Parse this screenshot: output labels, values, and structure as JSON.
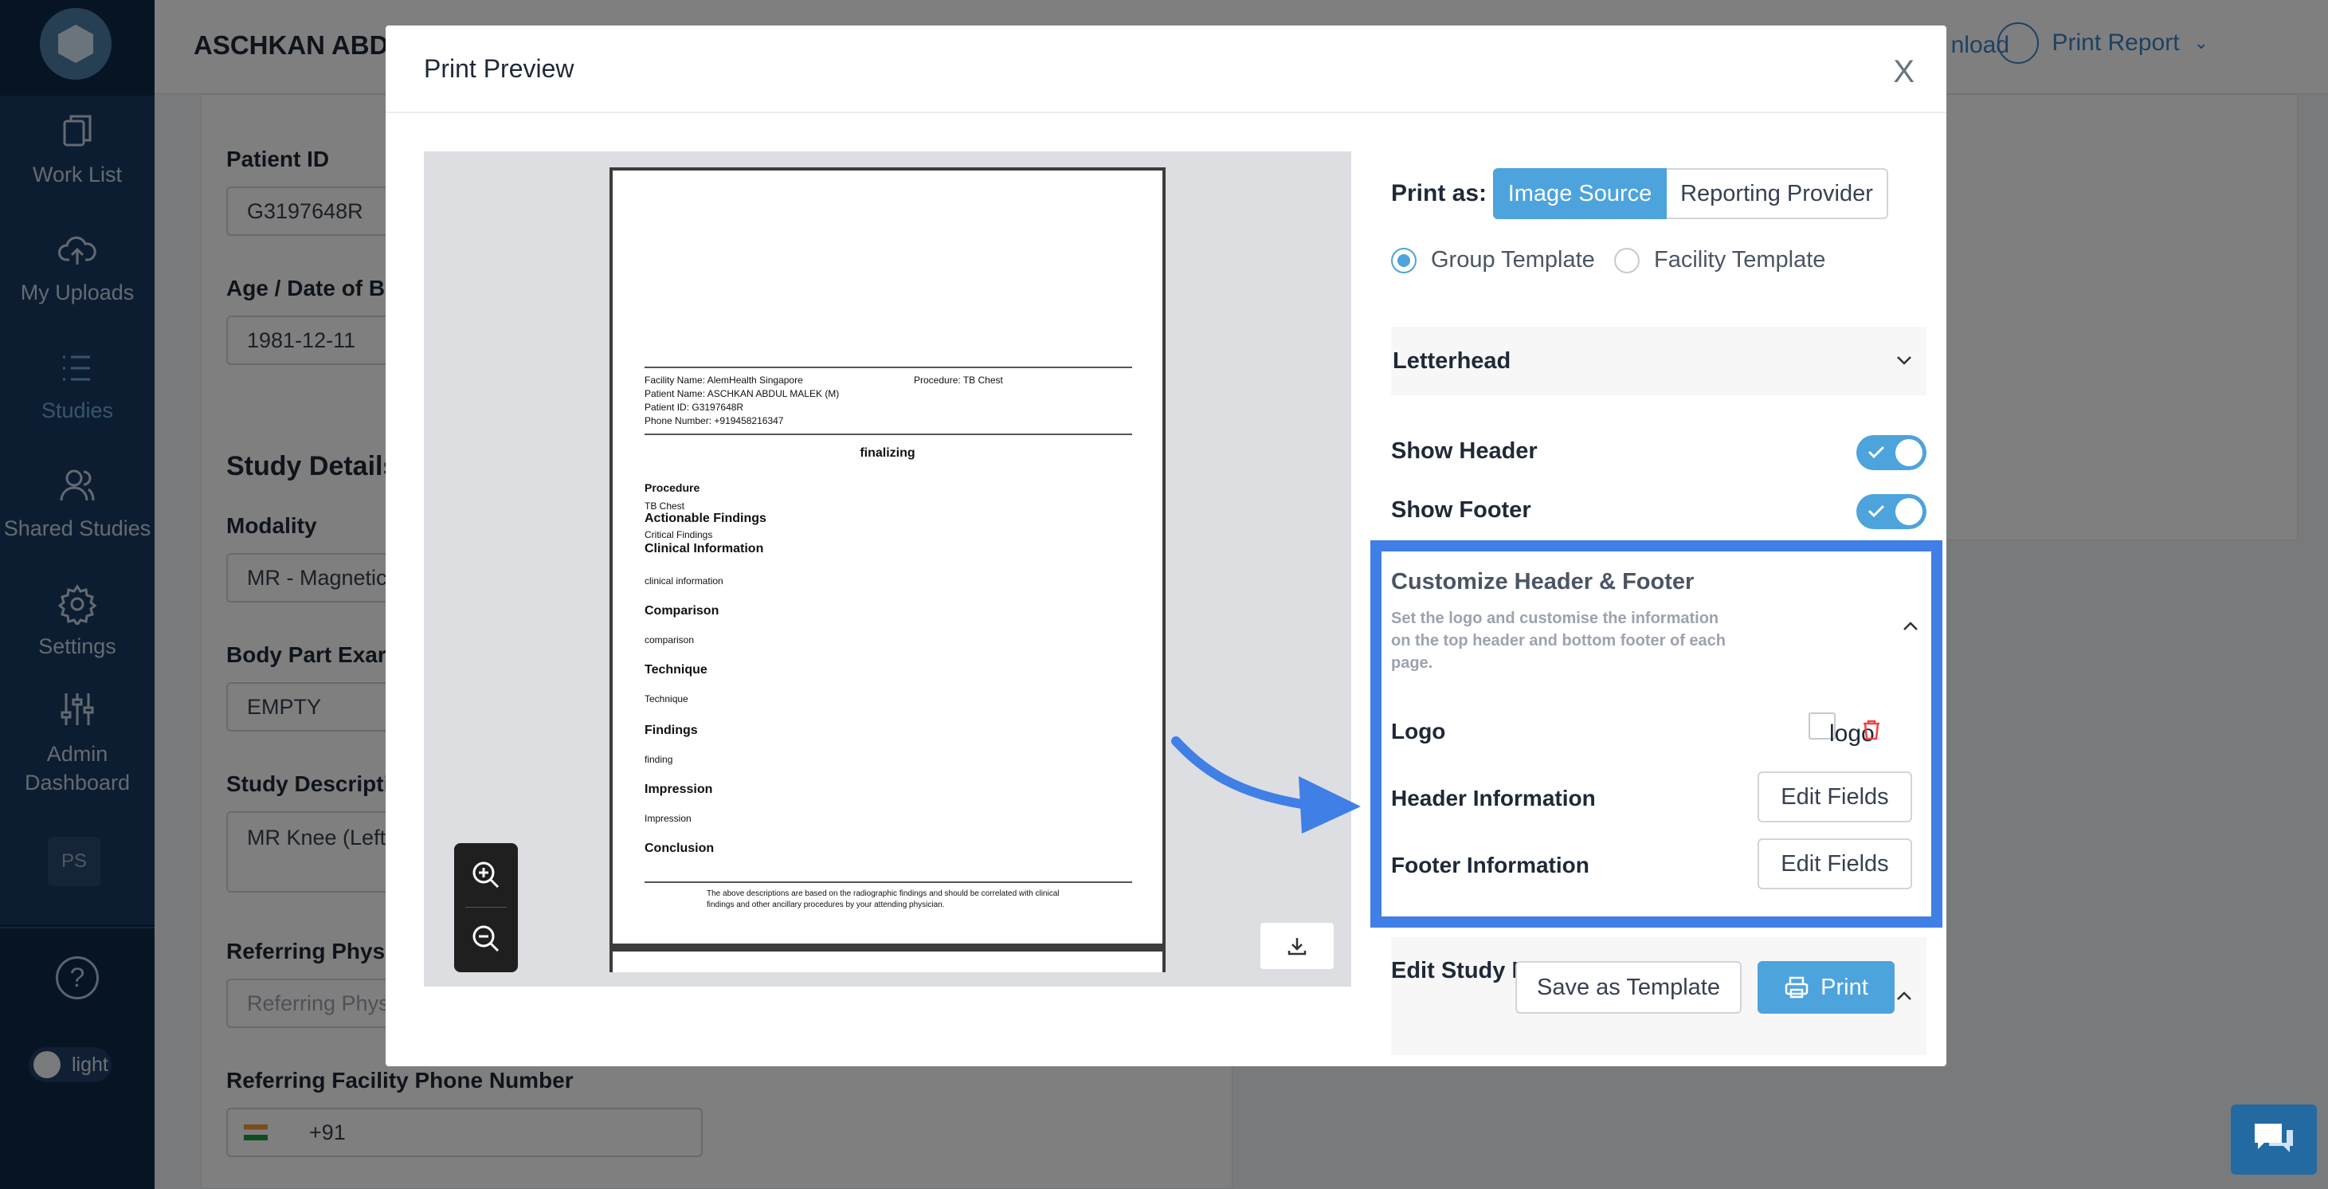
{
  "sidebar": {
    "items": [
      {
        "label": "Work List",
        "icon": "work-list-icon"
      },
      {
        "label": "My Uploads",
        "icon": "upload-cloud-icon"
      },
      {
        "label": "Studies",
        "icon": "list-icon",
        "active": true
      },
      {
        "label": "Shared Studies",
        "icon": "users-icon"
      },
      {
        "label": "Settings",
        "icon": "gear-icon"
      },
      {
        "label": "Admin Dashboard",
        "icon": "sliders-icon"
      }
    ],
    "avatar": "PS",
    "help": "?",
    "theme_label": "light"
  },
  "header": {
    "patient_name": "ASCHKAN ABDU",
    "download_label": "nload",
    "print_report_label": "Print Report"
  },
  "form": {
    "patient_id_label": "Patient ID",
    "patient_id_value": "G3197648R",
    "dob_label": "Age / Date of B",
    "dob_value": "1981-12-11",
    "study_details_title": "Study Details",
    "modality_label": "Modality",
    "modality_value": "MR - Magnetic",
    "body_part_label": "Body Part Exar",
    "body_part_value": "EMPTY",
    "study_desc_label": "Study Descripti",
    "study_desc_value": "MR Knee (Left",
    "ref_phys_label": "Referring Physi",
    "ref_phys_placeholder": "Referring Phys",
    "ref_phone_label": "Referring Facility Phone Number",
    "ref_phone_code": "+91"
  },
  "modal": {
    "title": "Print Preview",
    "close": "X",
    "print_as_label": "Print as:",
    "print_as_options": [
      "Image Source",
      "Reporting Provider"
    ],
    "templates": [
      {
        "label": "Group Template",
        "selected": true
      },
      {
        "label": "Facility Template",
        "selected": false
      }
    ],
    "letterhead": "Letterhead",
    "show_header_label": "Show Header",
    "show_header": true,
    "show_footer_label": "Show Footer",
    "show_footer": true,
    "customize": {
      "title": "Customize Header & Footer",
      "subtitle": "Set the logo and customise the information on the top header and bottom footer of each page.",
      "logo_label": "Logo",
      "logo_alt": "logo",
      "header_info_label": "Header Information",
      "footer_info_label": "Footer Information",
      "edit_fields": "Edit Fields"
    },
    "edit_study_label": "Edit Study Information",
    "save_template": "Save as Template",
    "print": "Print"
  },
  "report": {
    "facility": "Facility Name: AlemHealth Singapore",
    "procedure_header": "Procedure: TB Chest",
    "patient_name": "Patient Name: ASCHKAN ABDUL MALEK (M)",
    "patient_id": "Patient ID: G3197648R",
    "phone": "Phone Number: +919458216347",
    "status": "finalizing",
    "procedure_h": "Procedure",
    "procedure_v": "TB Chest",
    "actionable_h": "Actionable Findings",
    "actionable_v": "Critical Findings",
    "clinical_h": "Clinical Information",
    "clinical_v": "clinical information",
    "comparison_h": "Comparison",
    "comparison_v": "comparison",
    "technique_h": "Technique",
    "technique_v": "Technique",
    "findings_h": "Findings",
    "findings_v": "finding",
    "impression_h": "Impression",
    "impression_v": "Impression",
    "conclusion_h": "Conclusion",
    "footer_1": "The above descriptions are based on the radiographic findings and should be correlated with clinical",
    "footer_2": "findings and other ancillary procedures by your attending physician."
  },
  "colors": {
    "accent": "#4da3dc",
    "highlight": "#3f7fe6",
    "sidebar": "#0f2849"
  }
}
